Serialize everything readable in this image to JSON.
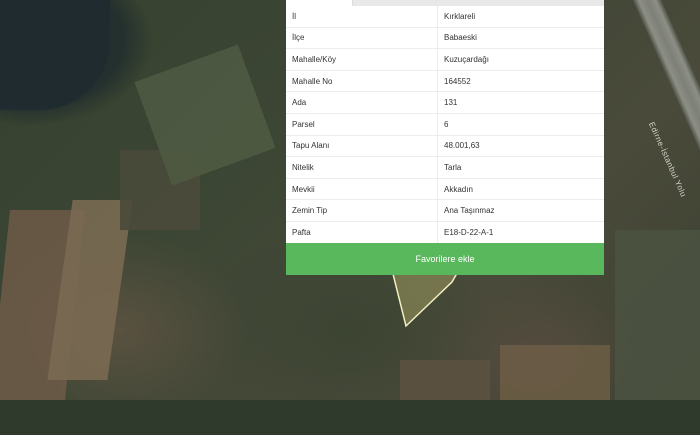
{
  "map": {
    "road_label": "Edirne-İstanbul Yolu"
  },
  "colors": {
    "button": "#59b85c",
    "parcel_outline": "#f2f0c0"
  },
  "info_table": [
    {
      "key": "İl",
      "value": "Kırklareli"
    },
    {
      "key": "İlçe",
      "value": "Babaeski"
    },
    {
      "key": "Mahalle/Köy",
      "value": "Kuzuçardağı"
    },
    {
      "key": "Mahalle No",
      "value": "164552"
    },
    {
      "key": "Ada",
      "value": "131"
    },
    {
      "key": "Parsel",
      "value": "6"
    },
    {
      "key": "Tapu Alanı",
      "value": "48.001,63"
    },
    {
      "key": "Nitelik",
      "value": "Tarla"
    },
    {
      "key": "Mevkii",
      "value": "Akkadın"
    },
    {
      "key": "Zemin Tip",
      "value": "Ana Taşınmaz"
    },
    {
      "key": "Pafta",
      "value": "E18-D-22-A-1"
    }
  ],
  "favorites_button": "Favorilere ekle"
}
